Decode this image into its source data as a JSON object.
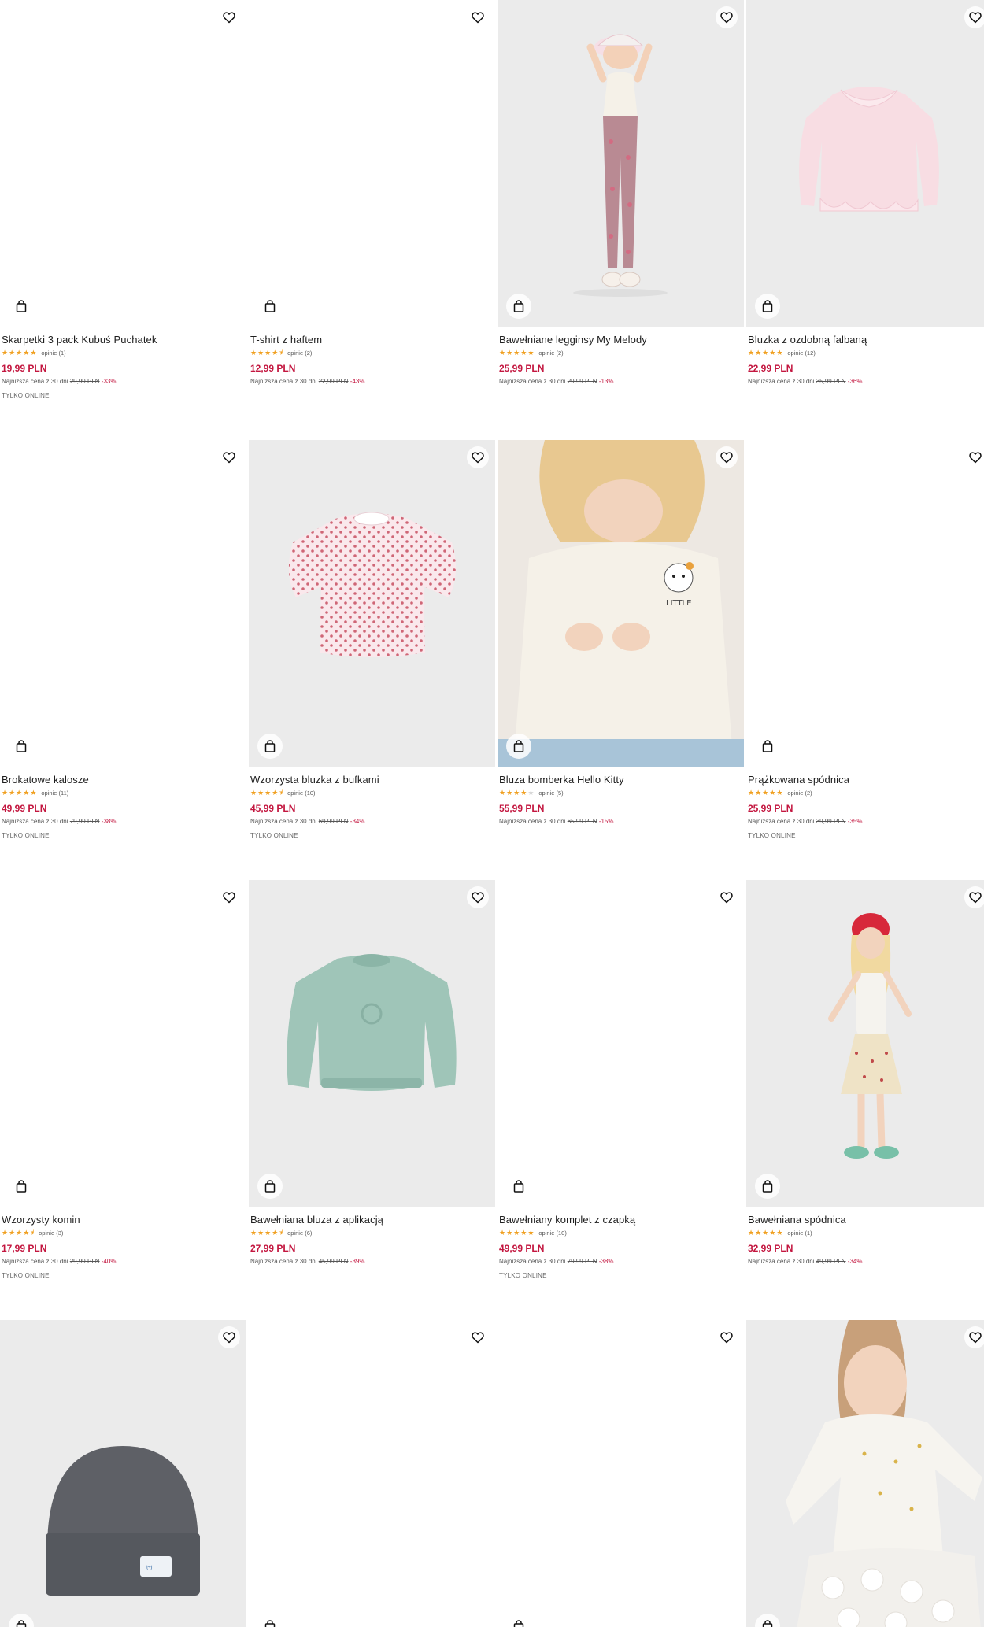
{
  "products": [
    {
      "title": "Skarpetki 3 pack Kubuś Puchatek",
      "stars": 5,
      "reviews": "opinie (1)",
      "price": "19,99 PLN",
      "lowest_label": "Najniższa cena z 30 dni",
      "old_price": "29,99 PLN",
      "discount": "-33%",
      "badge": "TYLKO ONLINE",
      "image": "blank"
    },
    {
      "title": "T-shirt z haftem",
      "stars": 4.5,
      "reviews": "opinie (2)",
      "price": "12,99 PLN",
      "lowest_label": "Najniższa cena z 30 dni",
      "old_price": "22,99 PLN",
      "discount": "-43%",
      "badge": "",
      "image": "blank"
    },
    {
      "title": "Bawełniane legginsy My Melody",
      "stars": 5,
      "reviews": "opinie (2)",
      "price": "25,99 PLN",
      "lowest_label": "Najniższa cena z 30 dni",
      "old_price": "29,99 PLN",
      "discount": "-13%",
      "badge": "",
      "image": "girl-leggings"
    },
    {
      "title": "Bluzka z ozdobną falbaną",
      "stars": 5,
      "reviews": "opinie (12)",
      "price": "22,99 PLN",
      "lowest_label": "Najniższa cena z 30 dni",
      "old_price": "35,99 PLN",
      "discount": "-36%",
      "badge": "",
      "image": "pink-blouse"
    },
    {
      "title": "Brokatowe kalosze",
      "stars": 5,
      "reviews": "opinie (11)",
      "price": "49,99 PLN",
      "lowest_label": "Najniższa cena z 30 dni",
      "old_price": "79,99 PLN",
      "discount": "-38%",
      "badge": "TYLKO ONLINE",
      "image": "blank"
    },
    {
      "title": "Wzorzysta bluzka z bufkami",
      "stars": 4.5,
      "reviews": "opinie (10)",
      "price": "45,99 PLN",
      "lowest_label": "Najniższa cena z 30 dni",
      "old_price": "69,99 PLN",
      "discount": "-34%",
      "badge": "TYLKO ONLINE",
      "image": "dotted-blouse"
    },
    {
      "title": "Bluza bomberka Hello Kitty",
      "stars": 4,
      "reviews": "opinie (5)",
      "price": "55,99 PLN",
      "lowest_label": "Najniższa cena z 30 dni",
      "old_price": "65,99 PLN",
      "discount": "-15%",
      "badge": "",
      "image": "girl-bomber"
    },
    {
      "title": "Prążkowana spódnica",
      "stars": 5,
      "reviews": "opinie (2)",
      "price": "25,99 PLN",
      "lowest_label": "Najniższa cena z 30 dni",
      "old_price": "39,99 PLN",
      "discount": "-35%",
      "badge": "TYLKO ONLINE",
      "image": "blank"
    },
    {
      "title": "Wzorzysty komin",
      "stars": 4.5,
      "reviews": "opinie (3)",
      "price": "17,99 PLN",
      "lowest_label": "Najniższa cena z 30 dni",
      "old_price": "29,99 PLN",
      "discount": "-40%",
      "badge": "TYLKO ONLINE",
      "image": "blank"
    },
    {
      "title": "Bawełniana bluza z aplikacją",
      "stars": 4.5,
      "reviews": "opinie (6)",
      "price": "27,99 PLN",
      "lowest_label": "Najniższa cena z 30 dni",
      "old_price": "45,99 PLN",
      "discount": "-39%",
      "badge": "",
      "image": "green-sweatshirt"
    },
    {
      "title": "Bawełniany komplet z czapką",
      "stars": 5,
      "reviews": "opinie (10)",
      "price": "49,99 PLN",
      "lowest_label": "Najniższa cena z 30 dni",
      "old_price": "79,99 PLN",
      "discount": "-38%",
      "badge": "TYLKO ONLINE",
      "image": "blank"
    },
    {
      "title": "Bawełniana spódnica",
      "stars": 5,
      "reviews": "opinie (1)",
      "price": "32,99 PLN",
      "lowest_label": "Najniższa cena z 30 dni",
      "old_price": "49,99 PLN",
      "discount": "-34%",
      "badge": "",
      "image": "girl-skirt"
    },
    {
      "title": "",
      "stars": 0,
      "reviews": "",
      "price": "",
      "lowest_label": "",
      "old_price": "",
      "discount": "",
      "badge": "",
      "image": "beanie"
    },
    {
      "title": "",
      "stars": 0,
      "reviews": "",
      "price": "",
      "lowest_label": "",
      "old_price": "",
      "discount": "",
      "badge": "",
      "image": "blank"
    },
    {
      "title": "",
      "stars": 0,
      "reviews": "",
      "price": "",
      "lowest_label": "",
      "old_price": "",
      "discount": "",
      "badge": "",
      "image": "blank"
    },
    {
      "title": "",
      "stars": 0,
      "reviews": "",
      "price": "",
      "lowest_label": "",
      "old_price": "",
      "discount": "",
      "badge": "",
      "image": "girl-tulle"
    }
  ],
  "colors": {
    "price": "#c3163f",
    "star": "#f0a020",
    "text": "#1e1e1e"
  },
  "icons": {
    "wishlist": "heart-icon",
    "cart": "shopping-bag-icon"
  }
}
